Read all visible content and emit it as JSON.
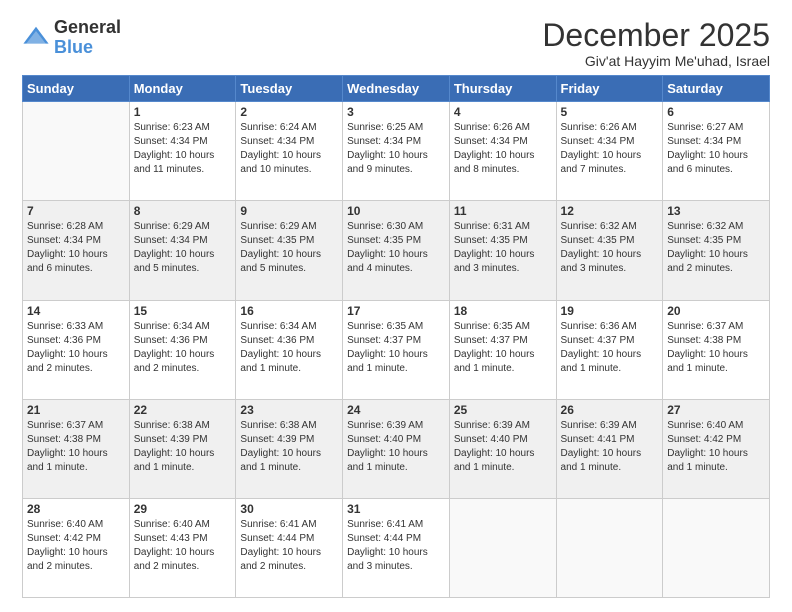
{
  "header": {
    "logo_general": "General",
    "logo_blue": "Blue",
    "title": "December 2025",
    "subtitle": "Giv'at Hayyim Me'uhad, Israel"
  },
  "columns": [
    "Sunday",
    "Monday",
    "Tuesday",
    "Wednesday",
    "Thursday",
    "Friday",
    "Saturday"
  ],
  "weeks": [
    {
      "days": [
        {
          "num": "",
          "info": "",
          "empty": true
        },
        {
          "num": "1",
          "info": "Sunrise: 6:23 AM\nSunset: 4:34 PM\nDaylight: 10 hours\nand 11 minutes."
        },
        {
          "num": "2",
          "info": "Sunrise: 6:24 AM\nSunset: 4:34 PM\nDaylight: 10 hours\nand 10 minutes."
        },
        {
          "num": "3",
          "info": "Sunrise: 6:25 AM\nSunset: 4:34 PM\nDaylight: 10 hours\nand 9 minutes."
        },
        {
          "num": "4",
          "info": "Sunrise: 6:26 AM\nSunset: 4:34 PM\nDaylight: 10 hours\nand 8 minutes."
        },
        {
          "num": "5",
          "info": "Sunrise: 6:26 AM\nSunset: 4:34 PM\nDaylight: 10 hours\nand 7 minutes."
        },
        {
          "num": "6",
          "info": "Sunrise: 6:27 AM\nSunset: 4:34 PM\nDaylight: 10 hours\nand 6 minutes."
        }
      ]
    },
    {
      "days": [
        {
          "num": "7",
          "info": "Sunrise: 6:28 AM\nSunset: 4:34 PM\nDaylight: 10 hours\nand 6 minutes."
        },
        {
          "num": "8",
          "info": "Sunrise: 6:29 AM\nSunset: 4:34 PM\nDaylight: 10 hours\nand 5 minutes."
        },
        {
          "num": "9",
          "info": "Sunrise: 6:29 AM\nSunset: 4:35 PM\nDaylight: 10 hours\nand 5 minutes."
        },
        {
          "num": "10",
          "info": "Sunrise: 6:30 AM\nSunset: 4:35 PM\nDaylight: 10 hours\nand 4 minutes."
        },
        {
          "num": "11",
          "info": "Sunrise: 6:31 AM\nSunset: 4:35 PM\nDaylight: 10 hours\nand 3 minutes."
        },
        {
          "num": "12",
          "info": "Sunrise: 6:32 AM\nSunset: 4:35 PM\nDaylight: 10 hours\nand 3 minutes."
        },
        {
          "num": "13",
          "info": "Sunrise: 6:32 AM\nSunset: 4:35 PM\nDaylight: 10 hours\nand 2 minutes."
        }
      ]
    },
    {
      "days": [
        {
          "num": "14",
          "info": "Sunrise: 6:33 AM\nSunset: 4:36 PM\nDaylight: 10 hours\nand 2 minutes."
        },
        {
          "num": "15",
          "info": "Sunrise: 6:34 AM\nSunset: 4:36 PM\nDaylight: 10 hours\nand 2 minutes."
        },
        {
          "num": "16",
          "info": "Sunrise: 6:34 AM\nSunset: 4:36 PM\nDaylight: 10 hours\nand 1 minute."
        },
        {
          "num": "17",
          "info": "Sunrise: 6:35 AM\nSunset: 4:37 PM\nDaylight: 10 hours\nand 1 minute."
        },
        {
          "num": "18",
          "info": "Sunrise: 6:35 AM\nSunset: 4:37 PM\nDaylight: 10 hours\nand 1 minute."
        },
        {
          "num": "19",
          "info": "Sunrise: 6:36 AM\nSunset: 4:37 PM\nDaylight: 10 hours\nand 1 minute."
        },
        {
          "num": "20",
          "info": "Sunrise: 6:37 AM\nSunset: 4:38 PM\nDaylight: 10 hours\nand 1 minute."
        }
      ]
    },
    {
      "days": [
        {
          "num": "21",
          "info": "Sunrise: 6:37 AM\nSunset: 4:38 PM\nDaylight: 10 hours\nand 1 minute."
        },
        {
          "num": "22",
          "info": "Sunrise: 6:38 AM\nSunset: 4:39 PM\nDaylight: 10 hours\nand 1 minute."
        },
        {
          "num": "23",
          "info": "Sunrise: 6:38 AM\nSunset: 4:39 PM\nDaylight: 10 hours\nand 1 minute."
        },
        {
          "num": "24",
          "info": "Sunrise: 6:39 AM\nSunset: 4:40 PM\nDaylight: 10 hours\nand 1 minute."
        },
        {
          "num": "25",
          "info": "Sunrise: 6:39 AM\nSunset: 4:40 PM\nDaylight: 10 hours\nand 1 minute."
        },
        {
          "num": "26",
          "info": "Sunrise: 6:39 AM\nSunset: 4:41 PM\nDaylight: 10 hours\nand 1 minute."
        },
        {
          "num": "27",
          "info": "Sunrise: 6:40 AM\nSunset: 4:42 PM\nDaylight: 10 hours\nand 1 minute."
        }
      ]
    },
    {
      "days": [
        {
          "num": "28",
          "info": "Sunrise: 6:40 AM\nSunset: 4:42 PM\nDaylight: 10 hours\nand 2 minutes."
        },
        {
          "num": "29",
          "info": "Sunrise: 6:40 AM\nSunset: 4:43 PM\nDaylight: 10 hours\nand 2 minutes."
        },
        {
          "num": "30",
          "info": "Sunrise: 6:41 AM\nSunset: 4:44 PM\nDaylight: 10 hours\nand 2 minutes."
        },
        {
          "num": "31",
          "info": "Sunrise: 6:41 AM\nSunset: 4:44 PM\nDaylight: 10 hours\nand 3 minutes."
        },
        {
          "num": "",
          "info": "",
          "empty": true
        },
        {
          "num": "",
          "info": "",
          "empty": true
        },
        {
          "num": "",
          "info": "",
          "empty": true
        }
      ]
    }
  ]
}
